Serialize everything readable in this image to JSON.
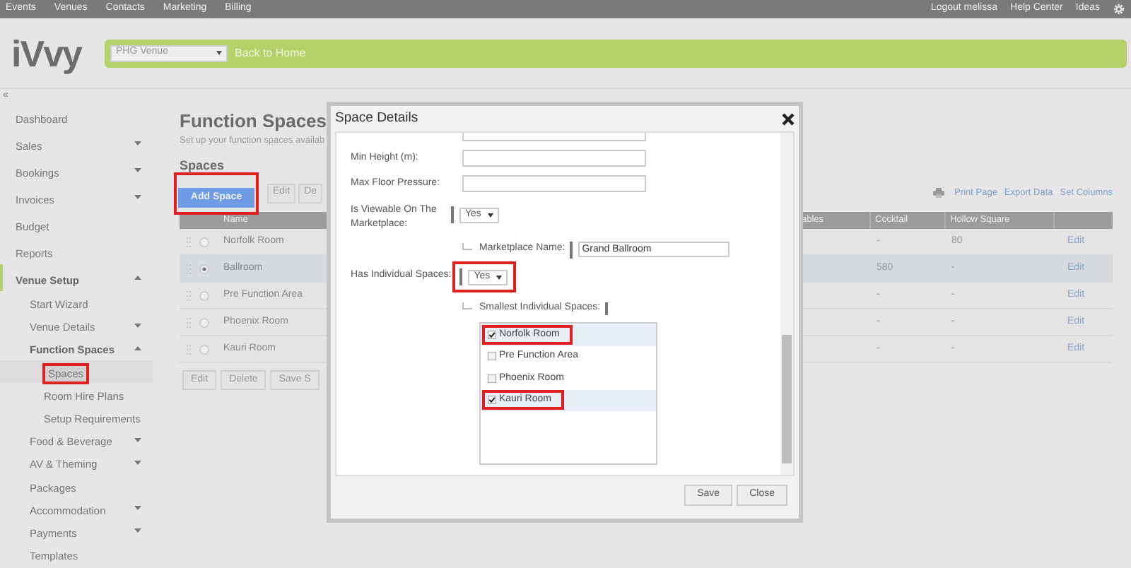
{
  "top_nav": {
    "items": [
      "Events",
      "Venues",
      "Contacts",
      "Marketing",
      "Billing"
    ],
    "right": [
      "Logout melissa",
      "Help Center",
      "Ideas"
    ]
  },
  "header": {
    "logo": "iVvy",
    "venue_select": "PHG Venue",
    "back_link": "Back to Home"
  },
  "collapse_toggle": "«",
  "sidebar": {
    "items": [
      {
        "label": "Dashboard",
        "selected": false
      },
      {
        "label": "Sales",
        "selected": false,
        "expanded": false
      },
      {
        "label": "Bookings",
        "selected": false,
        "expanded": false
      },
      {
        "label": "Invoices",
        "selected": false,
        "expanded": false
      },
      {
        "label": "Budget",
        "selected": false
      },
      {
        "label": "Reports",
        "selected": false
      },
      {
        "label": "Venue Setup",
        "selected": false,
        "expanded": true,
        "children": [
          {
            "label": "Start Wizard",
            "selected": false
          },
          {
            "label": "Venue Details",
            "selected": false,
            "expanded": false
          },
          {
            "label": "Function Spaces",
            "selected": false,
            "expanded": true,
            "children": [
              {
                "label": "Spaces",
                "selected": true,
                "highlighted": true
              },
              {
                "label": "Room Hire Plans",
                "selected": false
              },
              {
                "label": "Setup Requirements",
                "selected": false
              }
            ]
          },
          {
            "label": "Food & Beverage",
            "selected": false,
            "expanded": false
          },
          {
            "label": "AV & Theming",
            "selected": false,
            "expanded": false
          },
          {
            "label": "Packages",
            "selected": false
          },
          {
            "label": "Accommodation",
            "selected": false,
            "expanded": false
          },
          {
            "label": "Payments",
            "selected": false,
            "expanded": false
          },
          {
            "label": "Templates",
            "selected": false
          }
        ]
      }
    ]
  },
  "page": {
    "title": "Function Spaces",
    "subtitle": "Set up your function spaces availab",
    "section_title": "Spaces",
    "toolbar": [
      {
        "label": "Add Space",
        "kind": "primary",
        "highlighted": true
      },
      {
        "label": "Edit",
        "kind": "default",
        "highlighted": false
      },
      {
        "label": "De",
        "kind": "default",
        "highlighted": false
      }
    ],
    "actions": [
      "Print Page",
      "Export Data",
      "Set Columns"
    ],
    "table": {
      "columns": [
        "Name",
        "ables",
        "Cocktail",
        "Hollow Square"
      ],
      "rows": [
        {
          "selected": false,
          "name": "Norfolk Room",
          "cocktail": "-",
          "hollow_square": "80",
          "action": "Edit"
        },
        {
          "selected": true,
          "name": "Ballroom",
          "cocktail": "580",
          "hollow_square": "-",
          "action": "Edit"
        },
        {
          "selected": false,
          "name": "Pre Function Area",
          "cocktail": "-",
          "hollow_square": "-",
          "action": "Edit"
        },
        {
          "selected": false,
          "name": "Phoenix Room",
          "cocktail": "-",
          "hollow_square": "-",
          "action": "Edit"
        },
        {
          "selected": false,
          "name": "Kauri Room",
          "cocktail": "-",
          "hollow_square": "-",
          "action": "Edit"
        }
      ]
    },
    "bottom_buttons": [
      "Edit",
      "Delete",
      "Save S"
    ]
  },
  "dialog": {
    "title": "Space Details",
    "fields": [
      {
        "kind": "input",
        "label": "Min Height (m):"
      },
      {
        "kind": "input",
        "label": "Max Floor Pressure:"
      },
      {
        "kind": "select",
        "label": "Is Viewable On The Marketplace:",
        "value": "Yes",
        "highlighted": false
      },
      {
        "kind": "sub_input",
        "label": "Marketplace Name:",
        "value": "Grand Ballroom"
      },
      {
        "kind": "select",
        "label": "Has Individual Spaces:",
        "value": "Yes",
        "highlighted": true
      },
      {
        "kind": "sub_list",
        "label": "Smallest Individual Spaces:",
        "options": [
          {
            "label": "Norfolk Room",
            "checked": true,
            "highlighted": true
          },
          {
            "label": "Pre Function Area",
            "checked": false,
            "highlighted": false
          },
          {
            "label": "Phoenix Room",
            "checked": false,
            "highlighted": false
          },
          {
            "label": "Kauri Room",
            "checked": true,
            "highlighted": true
          }
        ]
      }
    ],
    "buttons": [
      "Save",
      "Close"
    ]
  }
}
